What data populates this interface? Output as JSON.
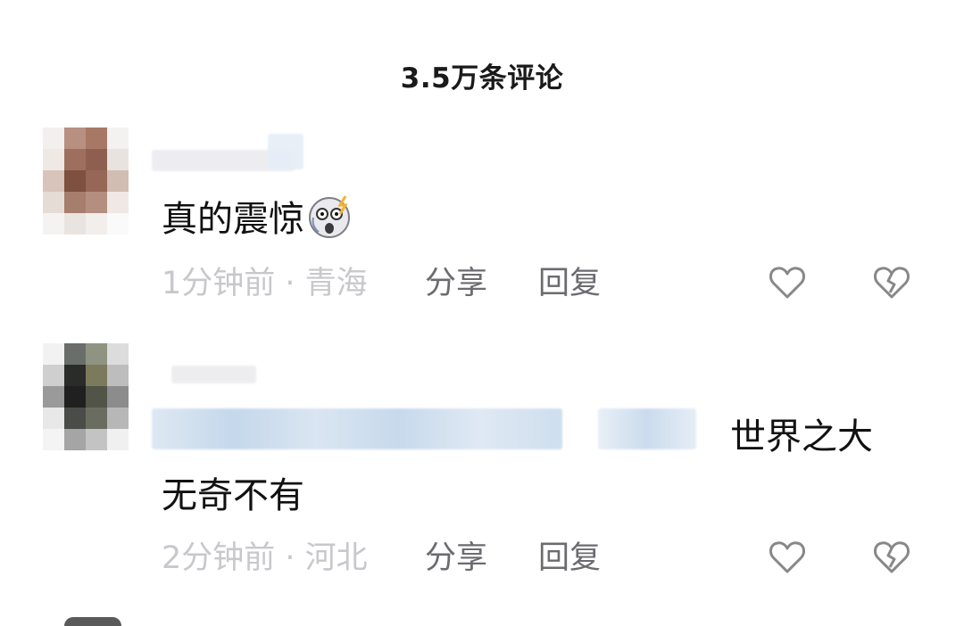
{
  "header": {
    "title": "3.5万条评论"
  },
  "comments": [
    {
      "text": "真的震惊",
      "emoji": "shocked-face-emoji",
      "meta": "1分钟前 · 青海",
      "share_label": "分享",
      "reply_label": "回复",
      "like_icon": "heart-outline-icon",
      "dislike_icon": "broken-heart-icon"
    },
    {
      "text_line1": "世界之大",
      "text_line2": "无奇不有",
      "meta": "2分钟前 · 河北",
      "share_label": "分享",
      "reply_label": "回复",
      "like_icon": "heart-outline-icon",
      "dislike_icon": "broken-heart-icon"
    }
  ],
  "colors": {
    "text": "#111111",
    "meta": "#c8c8cc",
    "action": "#6b6b70",
    "icon": "#888888",
    "blurred_mention": "#cfe0f2"
  }
}
